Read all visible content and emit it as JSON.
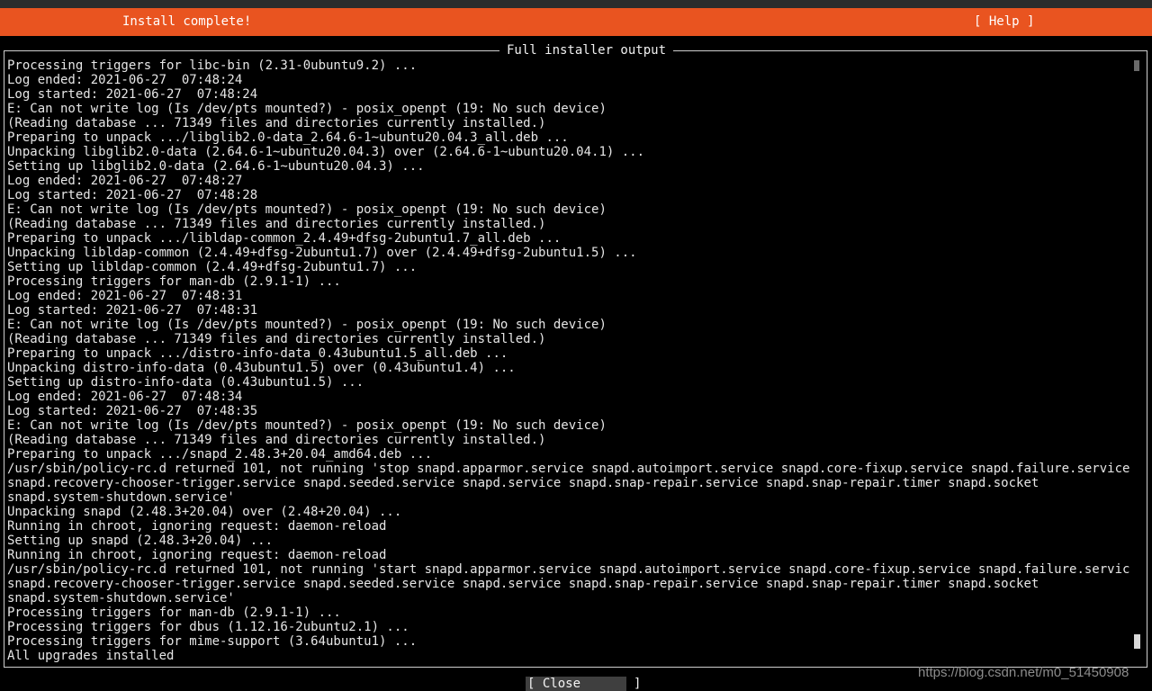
{
  "header": {
    "title": "Install complete!",
    "help_label": "[ Help ]"
  },
  "output_panel": {
    "title": "Full installer output",
    "lines": [
      "Processing triggers for libc-bin (2.31-0ubuntu9.2) ...",
      "Log ended: 2021-06-27  07:48:24",
      "Log started: 2021-06-27  07:48:24",
      "E: Can not write log (Is /dev/pts mounted?) - posix_openpt (19: No such device)",
      "(Reading database ... 71349 files and directories currently installed.)",
      "Preparing to unpack .../libglib2.0-data_2.64.6-1~ubuntu20.04.3_all.deb ...",
      "Unpacking libglib2.0-data (2.64.6-1~ubuntu20.04.3) over (2.64.6-1~ubuntu20.04.1) ...",
      "Setting up libglib2.0-data (2.64.6-1~ubuntu20.04.3) ...",
      "Log ended: 2021-06-27  07:48:27",
      "Log started: 2021-06-27  07:48:28",
      "E: Can not write log (Is /dev/pts mounted?) - posix_openpt (19: No such device)",
      "(Reading database ... 71349 files and directories currently installed.)",
      "Preparing to unpack .../libldap-common_2.4.49+dfsg-2ubuntu1.7_all.deb ...",
      "Unpacking libldap-common (2.4.49+dfsg-2ubuntu1.7) over (2.4.49+dfsg-2ubuntu1.5) ...",
      "Setting up libldap-common (2.4.49+dfsg-2ubuntu1.7) ...",
      "Processing triggers for man-db (2.9.1-1) ...",
      "Log ended: 2021-06-27  07:48:31",
      "Log started: 2021-06-27  07:48:31",
      "E: Can not write log (Is /dev/pts mounted?) - posix_openpt (19: No such device)",
      "(Reading database ... 71349 files and directories currently installed.)",
      "Preparing to unpack .../distro-info-data_0.43ubuntu1.5_all.deb ...",
      "Unpacking distro-info-data (0.43ubuntu1.5) over (0.43ubuntu1.4) ...",
      "Setting up distro-info-data (0.43ubuntu1.5) ...",
      "Log ended: 2021-06-27  07:48:34",
      "Log started: 2021-06-27  07:48:35",
      "E: Can not write log (Is /dev/pts mounted?) - posix_openpt (19: No such device)",
      "(Reading database ... 71349 files and directories currently installed.)",
      "Preparing to unpack .../snapd_2.48.3+20.04_amd64.deb ...",
      "/usr/sbin/policy-rc.d returned 101, not running 'stop snapd.apparmor.service snapd.autoimport.service snapd.core-fixup.service snapd.failure.service",
      "snapd.recovery-chooser-trigger.service snapd.seeded.service snapd.service snapd.snap-repair.service snapd.snap-repair.timer snapd.socket",
      "snapd.system-shutdown.service'",
      "Unpacking snapd (2.48.3+20.04) over (2.48+20.04) ...",
      "Running in chroot, ignoring request: daemon-reload",
      "Setting up snapd (2.48.3+20.04) ...",
      "Running in chroot, ignoring request: daemon-reload",
      "/usr/sbin/policy-rc.d returned 101, not running 'start snapd.apparmor.service snapd.autoimport.service snapd.core-fixup.service snapd.failure.service",
      "snapd.recovery-chooser-trigger.service snapd.seeded.service snapd.service snapd.snap-repair.service snapd.snap-repair.timer snapd.socket",
      "snapd.system-shutdown.service'",
      "Processing triggers for man-db (2.9.1-1) ...",
      "Processing triggers for dbus (1.12.16-2ubuntu2.1) ...",
      "Processing triggers for mime-support (3.64ubuntu1) ...",
      "All upgrades installed"
    ]
  },
  "footer": {
    "close_label": "[ Close       ]",
    "watermark": "https://blog.csdn.net/m0_51450908"
  },
  "colors": {
    "accent": "#e95420",
    "background": "#000000",
    "text": "#e6e6e6"
  }
}
